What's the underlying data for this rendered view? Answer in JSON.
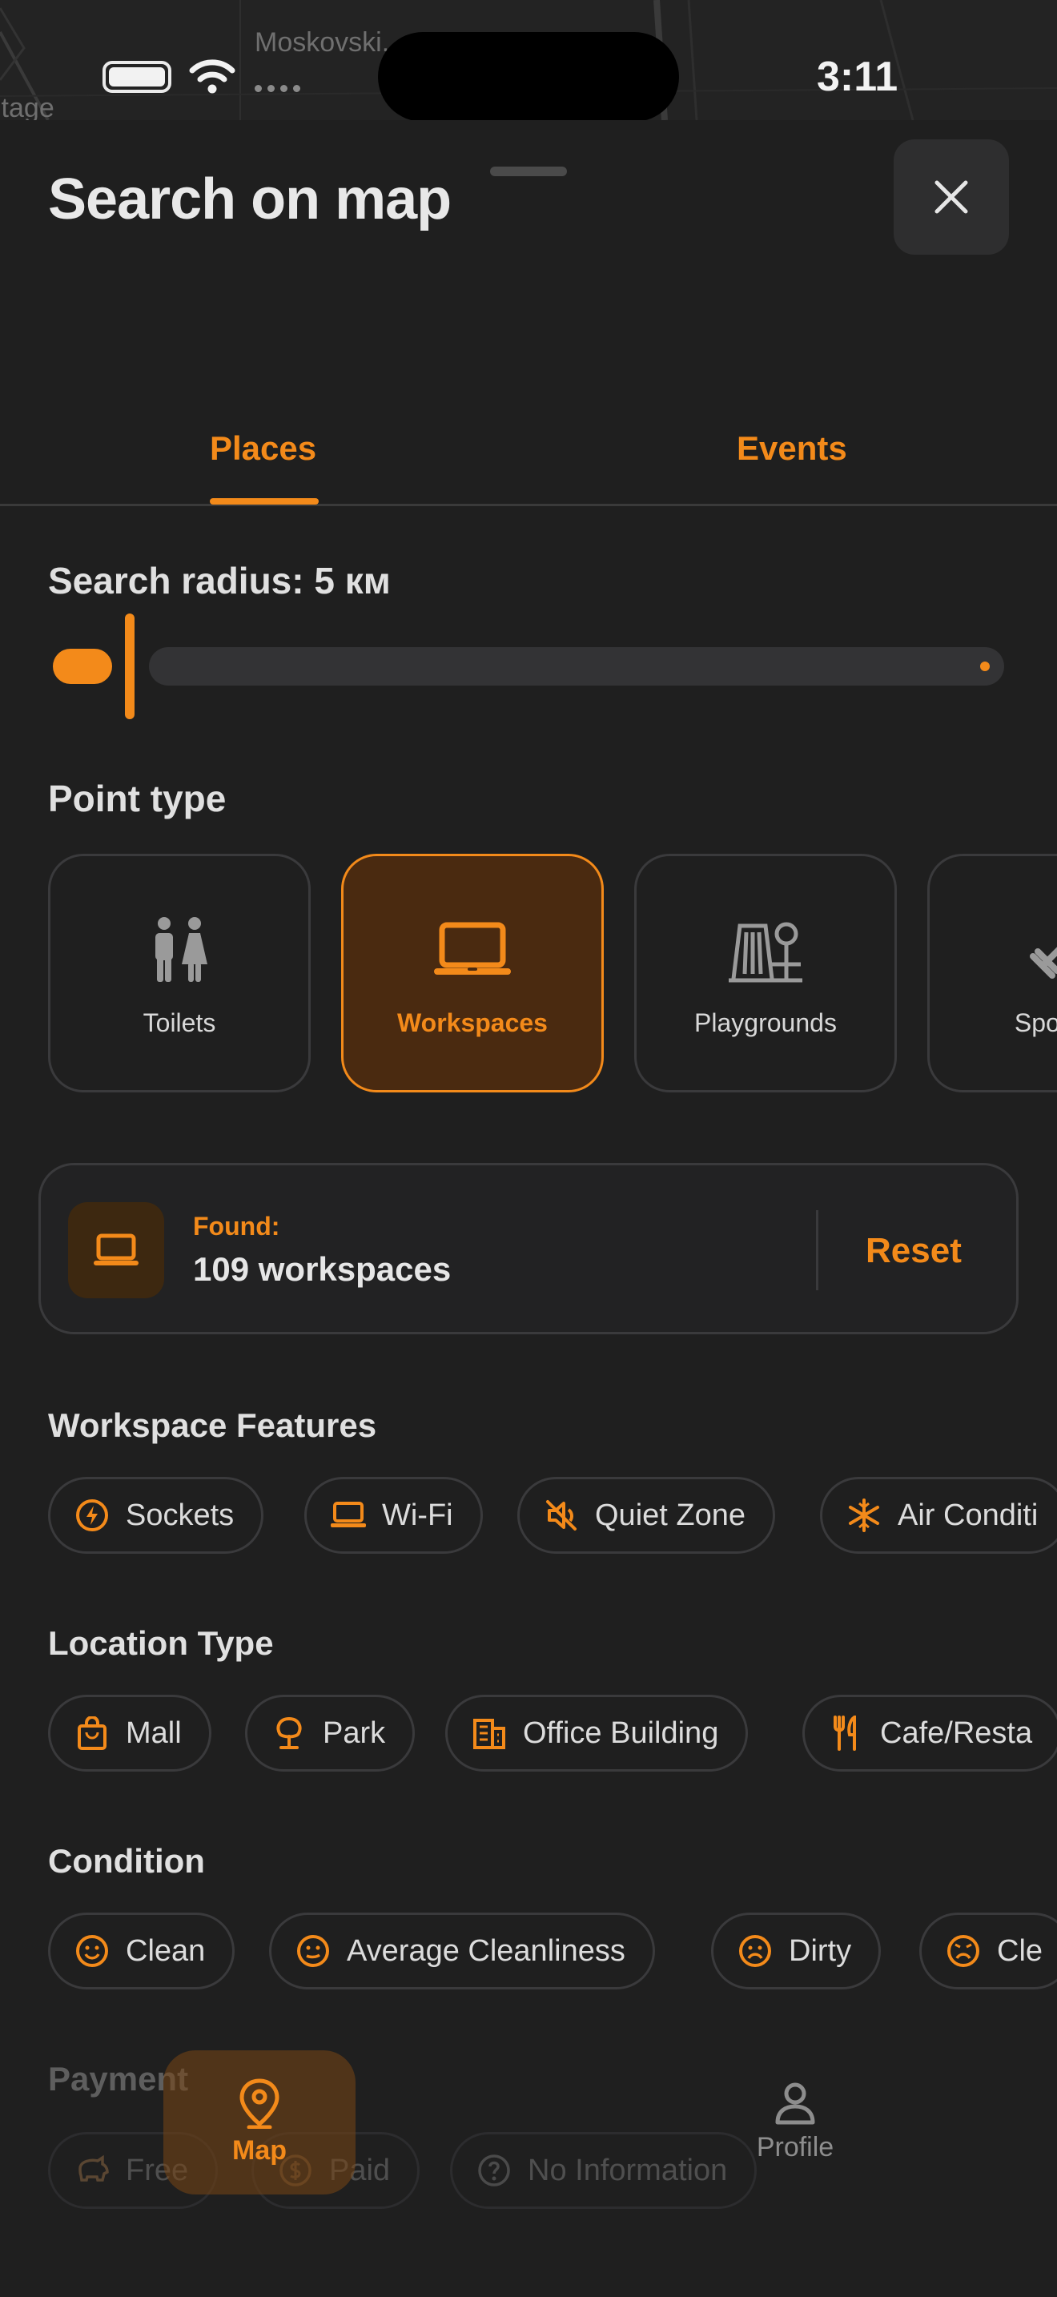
{
  "status_bar": {
    "time": "3:11"
  },
  "map_labels": {
    "street": "Moskovski...",
    "left": "itage"
  },
  "sheet": {
    "title": "Search on map"
  },
  "tabs": [
    {
      "label": "Places",
      "active": true
    },
    {
      "label": "Events",
      "active": false
    }
  ],
  "search_radius": {
    "label": "Search radius: 5 км",
    "value_km": 5,
    "fill_fraction": 0.05
  },
  "point_type": {
    "label": "Point type",
    "items": [
      {
        "label": "Toilets",
        "icon": "toilets-icon",
        "active": false
      },
      {
        "label": "Workspaces",
        "icon": "laptop-icon",
        "active": true
      },
      {
        "label": "Playgrounds",
        "icon": "playground-icon",
        "active": false
      },
      {
        "label": "Sport G",
        "icon": "dumbbell-icon",
        "active": false
      }
    ]
  },
  "found": {
    "label": "Found:",
    "count_text": "109 workspaces",
    "reset_label": "Reset"
  },
  "workspace_features": {
    "label": "Workspace Features",
    "items": [
      {
        "label": "Sockets",
        "icon": "bolt-icon"
      },
      {
        "label": "Wi-Fi",
        "icon": "laptop-icon"
      },
      {
        "label": "Quiet Zone",
        "icon": "mute-icon"
      },
      {
        "label": "Air Conditi",
        "icon": "snowflake-icon"
      }
    ]
  },
  "location_type": {
    "label": "Location Type",
    "items": [
      {
        "label": "Mall",
        "icon": "shopping-bag-icon"
      },
      {
        "label": "Park",
        "icon": "tree-icon"
      },
      {
        "label": "Office Building",
        "icon": "building-icon"
      },
      {
        "label": "Cafe/Resta",
        "icon": "fork-knife-icon"
      }
    ]
  },
  "condition": {
    "label": "Condition",
    "items": [
      {
        "label": "Clean",
        "icon": "smile-icon"
      },
      {
        "label": "Average Cleanliness",
        "icon": "neutral-face-icon"
      },
      {
        "label": "Dirty",
        "icon": "frown-icon"
      },
      {
        "label": "Cle",
        "icon": "angry-face-icon"
      }
    ]
  },
  "payment": {
    "label": "Payment",
    "items": [
      {
        "label": "Free",
        "icon": "piggy-bank-icon"
      },
      {
        "label": "Paid",
        "icon": "dollar-icon"
      },
      {
        "label": "No Information",
        "icon": "question-icon"
      }
    ]
  },
  "bottom_nav": [
    {
      "label": "Map",
      "icon": "map-pin-icon",
      "active": true
    },
    {
      "label": "Profile",
      "icon": "user-icon",
      "active": false
    }
  ],
  "colors": {
    "accent": "#f38a1a",
    "background": "#1f1f1f",
    "surface": "#2e2e2f",
    "border": "#3a3a3c"
  }
}
